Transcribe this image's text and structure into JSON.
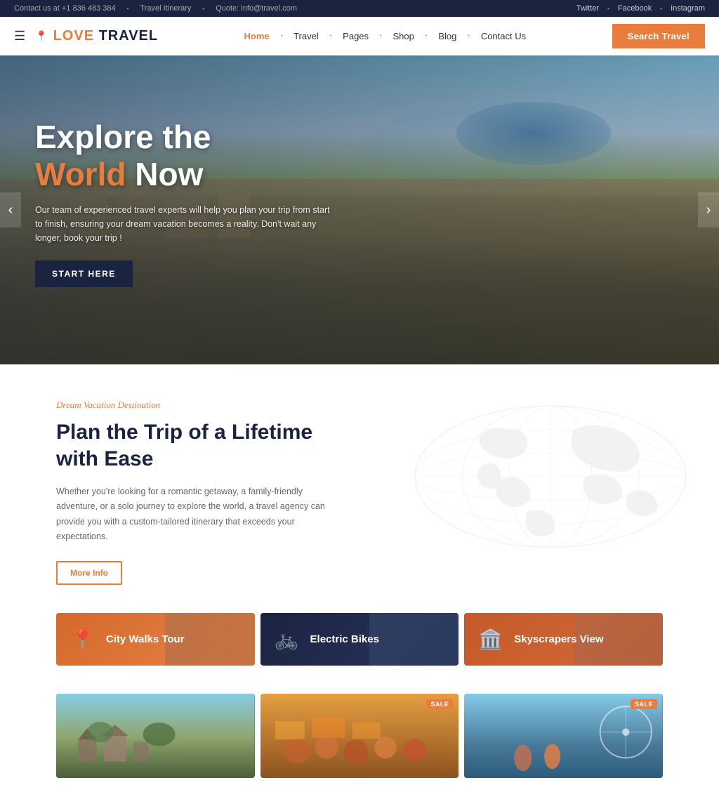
{
  "topbar": {
    "contact": "Contact us at +1 836 483 384",
    "itinerary": "Travel Itinerary",
    "quote": "Quote: info@travel.com",
    "dot": "•",
    "social": [
      "Twitter",
      "Facebook",
      "Instagram"
    ]
  },
  "header": {
    "logo": "LOVE TRAVEL",
    "logo_accent": "LOVE ",
    "nav": [
      {
        "label": "Home",
        "active": true
      },
      {
        "label": "Travel",
        "active": false
      },
      {
        "label": "Pages",
        "active": false
      },
      {
        "label": "Shop",
        "active": false
      },
      {
        "label": "Blog",
        "active": false
      },
      {
        "label": "Contact Us",
        "active": false
      }
    ],
    "search_btn": "Search Travel"
  },
  "hero": {
    "title_line1": "Explore the",
    "title_line2_orange": "World",
    "title_line2_white": " Now",
    "subtitle": "Our team of experienced travel experts will help you plan your trip from start to finish, ensuring your dream vacation becomes a reality. Don't wait any longer, book your trip !",
    "cta_btn": "START HERE",
    "arrow_left": "‹",
    "arrow_right": "›"
  },
  "plan_section": {
    "tag": "Dream Vacation Destination",
    "title": "Plan the Trip of a Lifetime with Ease",
    "desc": "Whether you're looking for a romantic getaway, a family-friendly adventure, or a solo journey to explore the world, a travel agency can provide you with a custom-tailored itinerary that exceeds your expectations.",
    "btn": "More Info"
  },
  "tour_cards": [
    {
      "label": "City Walks Tour",
      "icon": "📍",
      "color": "#d4692a"
    },
    {
      "label": "Electric Bikes",
      "icon": "🚲",
      "color": "#1a2340"
    },
    {
      "label": "Skyscrapers View",
      "icon": "🏛️",
      "color": "#c4592a"
    }
  ],
  "bottom_cards": [
    {
      "sale": false
    },
    {
      "sale": true,
      "sale_label": "SALE"
    },
    {
      "sale": true,
      "sale_label": "SALE"
    }
  ]
}
